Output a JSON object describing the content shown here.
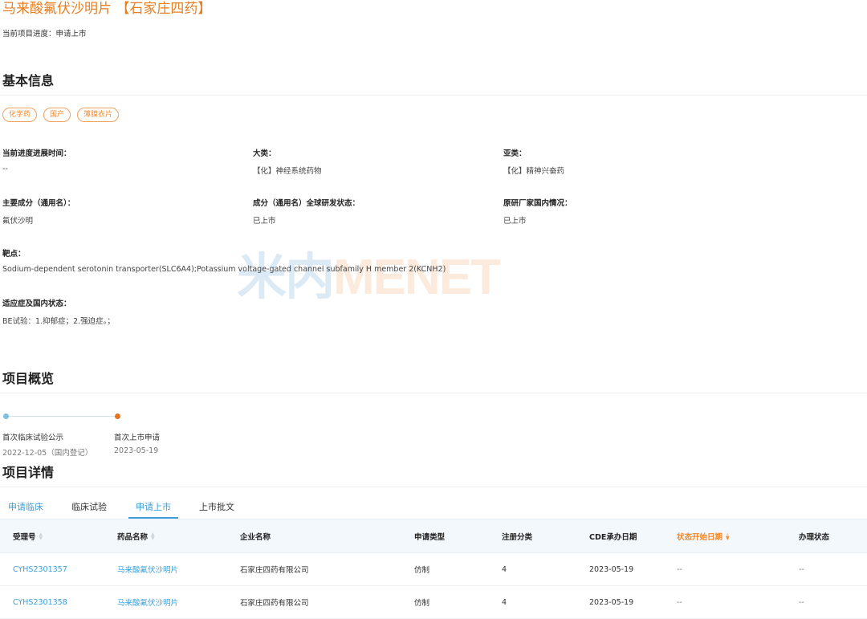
{
  "header": {
    "title": "马来酸氟伏沙明片 【石家庄四药】",
    "progress_label": "当前项目进度：",
    "progress_value": "申请上市"
  },
  "basic_info": {
    "section_title": "基本信息",
    "tags": [
      "化学药",
      "国产",
      "薄膜衣片"
    ],
    "fields": {
      "current_progress_time": {
        "label": "当前进度进展时间：",
        "value": "--"
      },
      "category": {
        "label": "大类：",
        "value": "【化】神经系统药物"
      },
      "subcategory": {
        "label": "亚类：",
        "value": "【化】精神兴奋药"
      },
      "main_ingredient": {
        "label": "主要成分（通用名）：",
        "value": "氟伏沙明"
      },
      "global_status": {
        "label": "成分（通用名）全球研发状态：",
        "value": "已上市"
      },
      "originator_status": {
        "label": "原研厂家国内情况：",
        "value": "已上市"
      },
      "target": {
        "label": "靶点：",
        "value": "Sodium-dependent serotonin transporter(SLC6A4);Potassium voltage-gated channel subfamily H member 2(KCNH2)"
      },
      "indication": {
        "label": "适应症及国内状态：",
        "value": "BE试验：1.抑郁症；2.强迫症。；"
      }
    }
  },
  "watermark": {
    "part1": "米内",
    "part2": "MENET"
  },
  "overview": {
    "section_title": "项目概览",
    "timeline_color_1": "#7fbfe0",
    "timeline_color_2": "#e8731f",
    "milestones": [
      {
        "label": "首次临床试验公示",
        "date": "2022-12-05（国内登记）"
      },
      {
        "label": "首次上市申请",
        "date": "2023-05-19"
      }
    ]
  },
  "details": {
    "section_title": "项目详情",
    "tabs": [
      "申请临床",
      "临床试验",
      "申请上市",
      "上市批文"
    ],
    "active_tab": "申请上市",
    "columns": [
      "受理号",
      "药品名称",
      "企业名称",
      "申请类型",
      "注册分类",
      "CDE承办日期",
      "状态开始日期",
      "办理状态"
    ],
    "rows": [
      [
        "CYHS2301357",
        "马来酸氟伏沙明片",
        "石家庄四药有限公司",
        "仿制",
        "4",
        "2023-05-19",
        "--",
        "--"
      ],
      [
        "CYHS2301358",
        "马来酸氟伏沙明片",
        "石家庄四药有限公司",
        "仿制",
        "4",
        "2023-05-19",
        "--",
        "--"
      ]
    ]
  },
  "colors": {
    "accent_orange": "#f08a2c",
    "link_blue": "#3a9fd8"
  }
}
